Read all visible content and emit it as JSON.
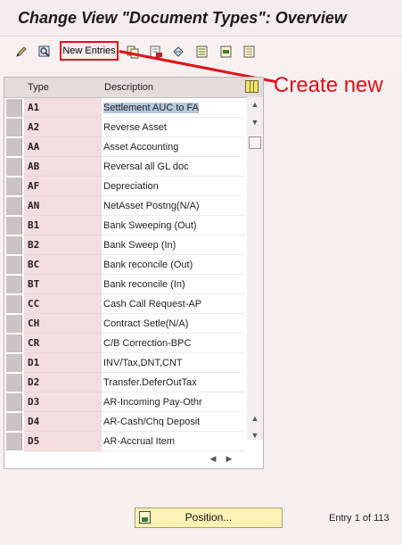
{
  "window": {
    "title": "Change View \"Document Types\": Overview"
  },
  "toolbar": {
    "new_entries_label": "New Entries",
    "icons": [
      "pencil-icon",
      "display-change-icon",
      "copy-icon",
      "delete-icon",
      "undo-icon",
      "select-all-icon",
      "select-block-icon",
      "deselect-all-icon"
    ]
  },
  "annotation": {
    "text": "Create new",
    "color": "#e0101a"
  },
  "table": {
    "headers": {
      "type": "Type",
      "description": "Description"
    },
    "rows": [
      {
        "type": "A1",
        "description": "Settlement AUC to FA",
        "selected": true
      },
      {
        "type": "A2",
        "description": "Reverse Asset"
      },
      {
        "type": "AA",
        "description": "Asset Accounting"
      },
      {
        "type": "AB",
        "description": "Reversal all GL doc"
      },
      {
        "type": "AF",
        "description": "Depreciation"
      },
      {
        "type": "AN",
        "description": "NetAsset Postng(N/A)"
      },
      {
        "type": "B1",
        "description": "Bank Sweeping (Out)"
      },
      {
        "type": "B2",
        "description": "Bank Sweep (In)"
      },
      {
        "type": "BC",
        "description": "Bank reconcile (Out)"
      },
      {
        "type": "BT",
        "description": "Bank reconcile (In)"
      },
      {
        "type": "CC",
        "description": "Cash Call Request-AP"
      },
      {
        "type": "CH",
        "description": "Contract Setle(N/A)"
      },
      {
        "type": "CR",
        "description": "C/B Correction-BPC"
      },
      {
        "type": "D1",
        "description": "INV/Tax,DNT,CNT"
      },
      {
        "type": "D2",
        "description": "Transfer.DeferOutTax"
      },
      {
        "type": "D3",
        "description": "AR-Incoming Pay-Othr"
      },
      {
        "type": "D4",
        "description": "AR-Cash/Chq Deposit"
      },
      {
        "type": "D5",
        "description": "AR-Accrual Item"
      }
    ]
  },
  "footer": {
    "position_label": "Position...",
    "entry_info": "Entry 1 of 113"
  }
}
